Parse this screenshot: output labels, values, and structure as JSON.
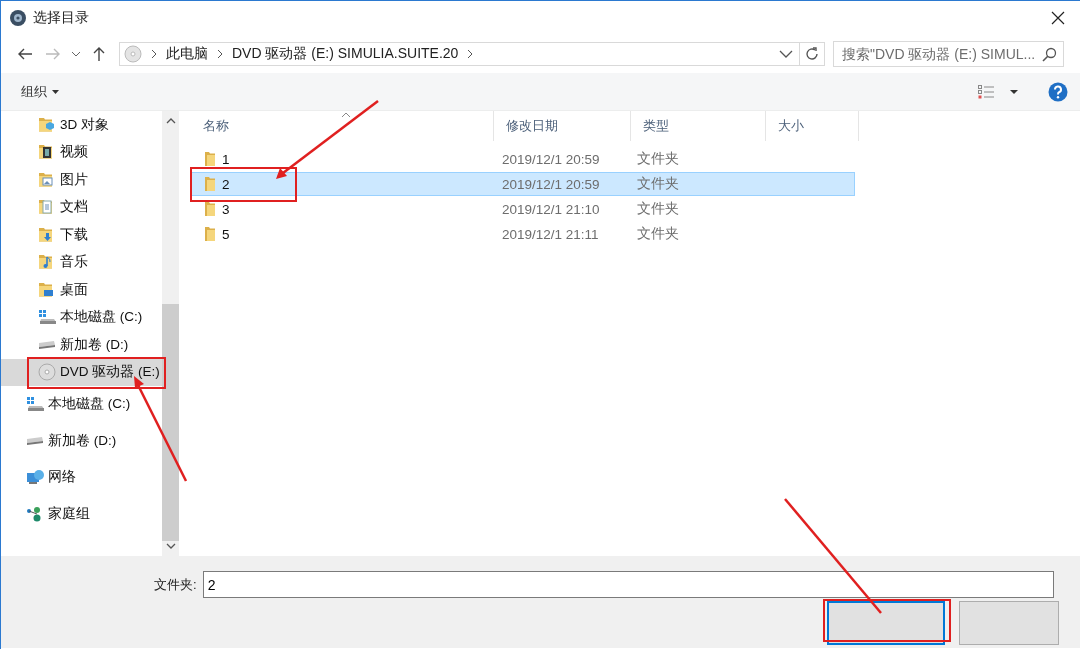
{
  "window": {
    "title": "选择目录"
  },
  "navigation": {
    "back_enabled": true,
    "forward_enabled": false
  },
  "address_bar": {
    "crumbs": [
      "此电脑",
      "DVD 驱动器 (E:) SIMULIA.SUITE.20"
    ]
  },
  "search": {
    "placeholder": "搜索\"DVD 驱动器 (E:) SIMUL..."
  },
  "toolbar": {
    "organize": "组织"
  },
  "sidebar": {
    "nested_items": [
      {
        "label": "3D 对象",
        "kind": "objects",
        "selected": false
      },
      {
        "label": "视频",
        "kind": "video",
        "selected": false
      },
      {
        "label": "图片",
        "kind": "pictures",
        "selected": false
      },
      {
        "label": "文档",
        "kind": "documents",
        "selected": false
      },
      {
        "label": "下载",
        "kind": "downloads",
        "selected": false
      },
      {
        "label": "音乐",
        "kind": "music",
        "selected": false
      },
      {
        "label": "桌面",
        "kind": "desktop",
        "selected": false
      },
      {
        "label": "本地磁盘 (C:)",
        "kind": "system-drive",
        "selected": false
      },
      {
        "label": "新加卷 (D:)",
        "kind": "drive",
        "selected": false
      },
      {
        "label": "DVD 驱动器 (E:)",
        "kind": "dvd",
        "selected": true
      }
    ],
    "items": [
      {
        "label": "本地磁盘 (C:)",
        "kind": "system-drive",
        "selected": false
      },
      {
        "label": "新加卷 (D:)",
        "kind": "drive",
        "selected": false
      },
      {
        "label": "网络",
        "kind": "network",
        "selected": false
      },
      {
        "label": "家庭组",
        "kind": "homegroup",
        "selected": false
      }
    ]
  },
  "file_list": {
    "columns": [
      "名称",
      "修改日期",
      "类型",
      "大小"
    ],
    "rows": [
      {
        "name": "1",
        "modified": "2019/12/1 20:59",
        "type": "文件夹",
        "selected": false
      },
      {
        "name": "2",
        "modified": "2019/12/1 20:59",
        "type": "文件夹",
        "selected": true
      },
      {
        "name": "3",
        "modified": "2019/12/1 21:10",
        "type": "文件夹",
        "selected": false
      },
      {
        "name": "5",
        "modified": "2019/12/1 21:11",
        "type": "文件夹",
        "selected": false
      }
    ]
  },
  "footer": {
    "folder_label": "文件夹:",
    "folder_value": "2"
  }
}
